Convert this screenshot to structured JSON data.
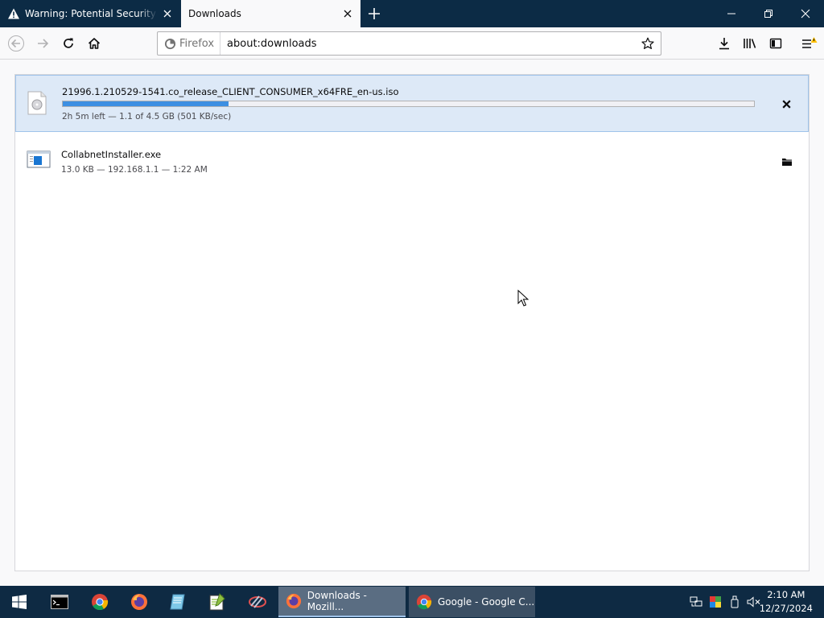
{
  "tabs": [
    {
      "title": "Warning: Potential Security Risk Ahead",
      "active": false
    },
    {
      "title": "Downloads",
      "active": true
    }
  ],
  "navbar": {
    "identity_label": "Firefox",
    "url": "about:downloads"
  },
  "downloads": [
    {
      "filename": "21996.1.210529-1541.co_release_CLIENT_CONSUMER_x64FRE_en-us.iso",
      "status": "2h 5m left — 1.1 of 4.5 GB (501 KB/sec)",
      "progress": 0.24,
      "icon": "disc-image-icon",
      "action": "cancel-icon"
    },
    {
      "filename": "CollabnetInstaller.exe",
      "status": "13.0 KB — 192.168.1.1 — 1:22 AM",
      "icon": "exe-file-icon",
      "action": "folder-icon"
    }
  ],
  "taskbar": {
    "apps": [
      {
        "label": "Downloads - Mozill...",
        "active": true
      },
      {
        "label": "Google - Google C...",
        "active": false
      }
    ],
    "time": "2:10 AM",
    "date": "12/27/2024"
  },
  "colors": {
    "accent": "#3d8fe2",
    "tabstrip": "#0c2b45",
    "taskbar": "#0e2a43",
    "selected_row": "#dde9f7"
  }
}
